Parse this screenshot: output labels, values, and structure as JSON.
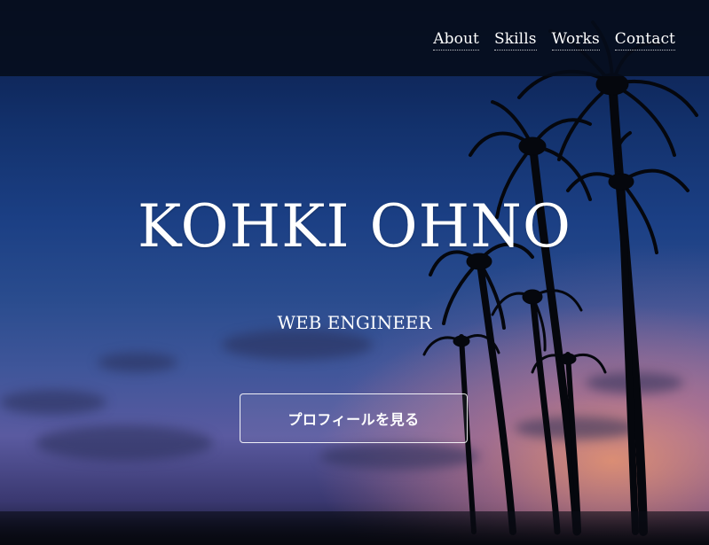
{
  "nav": {
    "items": [
      {
        "label": "About"
      },
      {
        "label": "Skills"
      },
      {
        "label": "Works"
      },
      {
        "label": "Contact"
      }
    ]
  },
  "hero": {
    "title": "KOHKI OHNO",
    "subtitle": "WEB ENGINEER",
    "cta_label": "プロフィールを見る"
  },
  "colors": {
    "topbar": "#060c1a",
    "text": "#ffffff",
    "sky_top": "#0b1a44",
    "sky_sunset": "#ec966e"
  }
}
